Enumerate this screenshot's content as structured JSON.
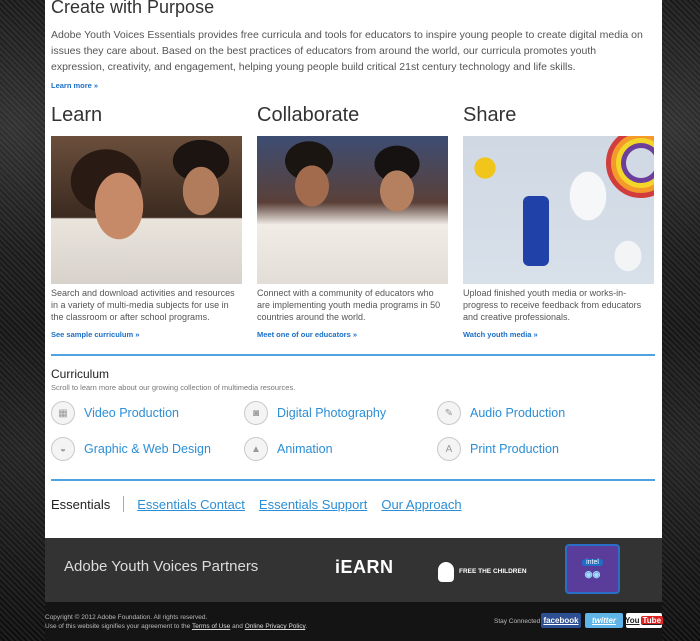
{
  "intro": {
    "title": "Create with Purpose",
    "text": "Adobe Youth Voices Essentials provides free curricula and tools for educators to inspire young people to create digital media on issues they care about. Based on the best practices of educators from around the world, our curricula promotes youth expression, creativity, and engagement, helping young people build critical 21st century technology and life skills.",
    "learn_more": "Learn more »"
  },
  "columns": [
    {
      "title": "Learn",
      "text": "Search and download activities and resources in a variety of multi-media subjects for use in the classroom or after school programs.",
      "link": "See sample curriculum »"
    },
    {
      "title": "Collaborate",
      "text": "Connect with a community of educators who are implementing youth media programs in 50 countries around the world.",
      "link": "Meet one of our educators »"
    },
    {
      "title": "Share",
      "text": "Upload finished youth media or works-in-progress to receive feedback from educators and creative professionals.",
      "link": "Watch youth media »"
    }
  ],
  "curriculum": {
    "title": "Curriculum",
    "subtitle": "Scroll to learn more about our growing collection of multimedia resources.",
    "items": [
      {
        "label": "Video Production",
        "icon": "video-icon"
      },
      {
        "label": "Digital Photography",
        "icon": "camera-icon"
      },
      {
        "label": "Audio Production",
        "icon": "microphone-icon"
      },
      {
        "label": "Graphic & Web Design",
        "icon": "design-icon"
      },
      {
        "label": "Animation",
        "icon": "pen-nib-icon"
      },
      {
        "label": "Print Production",
        "icon": "type-icon"
      }
    ]
  },
  "essentials_nav": {
    "active": "Essentials",
    "links": [
      "Essentials Contact",
      "Essentials Support",
      "Our Approach"
    ]
  },
  "partners": {
    "title": "Adobe Youth Voices Partners",
    "iearn": "iEARN",
    "ftc": "FREE THE CHILDREN"
  },
  "footer": {
    "copyright": "Copyright © 2012 Adobe Foundation. All rights reserved.",
    "agreement_prefix": "Use of this website signifies your agreement to the",
    "terms": "Terms of Use",
    "and": "and",
    "privacy": "Online Privacy Policy",
    "stay_connected": "Stay Connected",
    "facebook": "facebook",
    "twitter": "twitter",
    "youtube_a": "You",
    "youtube_b": "Tube"
  },
  "colors": {
    "link_blue": "#2b8ed6",
    "divider_blue": "#4fa3e0",
    "partners_bg": "#333333"
  }
}
